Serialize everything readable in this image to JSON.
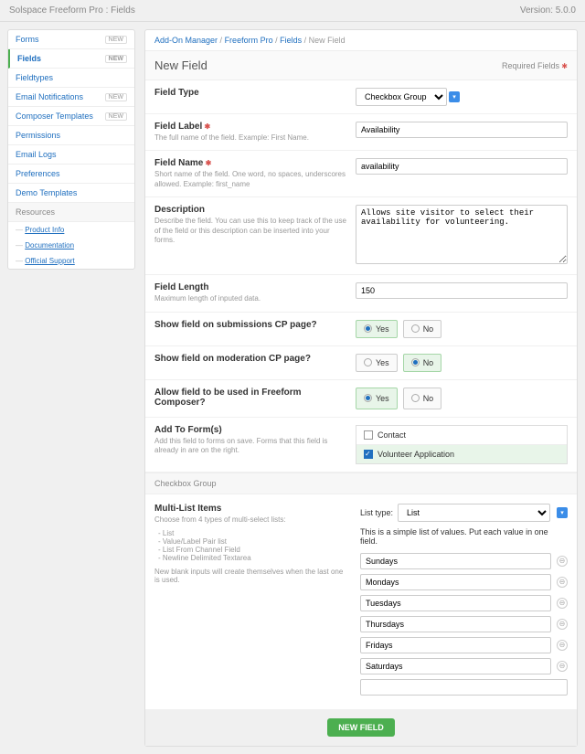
{
  "topbar": {
    "title": "Solspace Freeform Pro : Fields",
    "version": "Version: 5.0.0"
  },
  "sidebar": {
    "items": [
      {
        "label": "Forms",
        "badge": "NEW"
      },
      {
        "label": "Fields",
        "badge": "NEW",
        "active": true
      },
      {
        "label": "Fieldtypes"
      },
      {
        "label": "Email Notifications",
        "badge": "NEW"
      },
      {
        "label": "Composer Templates",
        "badge": "NEW"
      },
      {
        "label": "Permissions"
      },
      {
        "label": "Email Logs"
      },
      {
        "label": "Preferences"
      },
      {
        "label": "Demo Templates"
      }
    ],
    "resources_header": "Resources",
    "resources": [
      {
        "label": "Product Info"
      },
      {
        "label": "Documentation"
      },
      {
        "label": "Official Support"
      }
    ]
  },
  "crumbs": {
    "c1": "Add-On Manager",
    "c2": "Freeform Pro",
    "c3": "Fields",
    "c4": "New Field"
  },
  "panel": {
    "title": "New Field",
    "req": "Required Fields"
  },
  "fields": {
    "type": {
      "label": "Field Type",
      "value": "Checkbox Group"
    },
    "labelf": {
      "label": "Field Label",
      "help": "The full name of the field. Example: First Name.",
      "value": "Availability"
    },
    "name": {
      "label": "Field Name",
      "help": "Short name of the field. One word, no spaces, underscores allowed. Example: first_name",
      "value": "availability"
    },
    "desc": {
      "label": "Description",
      "help": "Describe the field. You can use this to keep track of the use of the field or this description can be inserted into your forms.",
      "value": "Allows site visitor to select their availability for volunteering."
    },
    "length": {
      "label": "Field Length",
      "help": "Maximum length of inputed data.",
      "value": "150"
    },
    "showsub": {
      "label": "Show field on submissions CP page?",
      "yes": "Yes",
      "no": "No"
    },
    "showmod": {
      "label": "Show field on moderation CP page?",
      "yes": "Yes",
      "no": "No"
    },
    "allow": {
      "label": "Allow field to be used in Freeform Composer?",
      "yes": "Yes",
      "no": "No"
    },
    "addform": {
      "label": "Add To Form(s)",
      "help": "Add this field to forms on save. Forms that this field is already in are on the right.",
      "opt1": "Contact",
      "opt2": "Volunteer Application"
    }
  },
  "section": {
    "title": "Checkbox Group"
  },
  "multi": {
    "label": "Multi-List Items",
    "help": "Choose from 4 types of multi-select lists:",
    "types": [
      "List",
      "Value/Label Pair list",
      "List From Channel Field",
      "Newline Delimited Textarea"
    ],
    "note": "New blank inputs will create themselves when the last one is used.",
    "lt_label": "List type:",
    "lt_value": "List",
    "lt_help": "This is a simple list of values. Put each value in one field.",
    "items": [
      "Sundays",
      "Mondays",
      "Tuesdays",
      "Thursdays",
      "Fridays",
      "Saturdays",
      ""
    ]
  },
  "footer": {
    "btn": "NEW FIELD"
  }
}
